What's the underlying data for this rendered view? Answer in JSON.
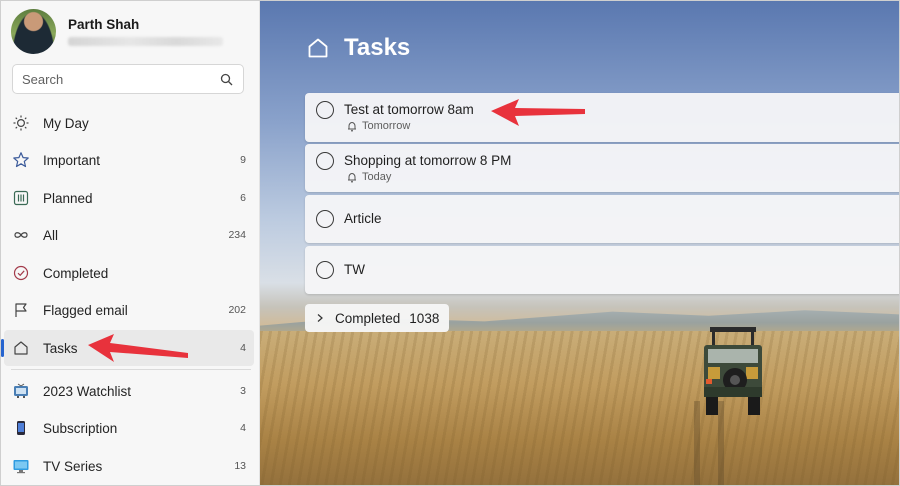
{
  "profile": {
    "name": "Parth Shah"
  },
  "search": {
    "placeholder": "Search"
  },
  "sidebar": {
    "items": [
      {
        "label": "My Day",
        "count": "",
        "icon": "sun-icon"
      },
      {
        "label": "Important",
        "count": "9",
        "icon": "star-icon"
      },
      {
        "label": "Planned",
        "count": "6",
        "icon": "calendar-icon"
      },
      {
        "label": "All",
        "count": "234",
        "icon": "infinity-icon"
      },
      {
        "label": "Completed",
        "count": "",
        "icon": "check-circle-icon"
      },
      {
        "label": "Flagged email",
        "count": "202",
        "icon": "flag-icon"
      },
      {
        "label": "Tasks",
        "count": "4",
        "icon": "home-icon"
      }
    ],
    "lists": [
      {
        "label": "2023 Watchlist",
        "count": "3",
        "icon": "tv-icon"
      },
      {
        "label": "Subscription",
        "count": "4",
        "icon": "phone-icon"
      },
      {
        "label": "TV Series",
        "count": "13",
        "icon": "monitor-icon"
      }
    ]
  },
  "main": {
    "title": "Tasks",
    "tasks": [
      {
        "title": "Test at tomorrow 8am",
        "reminder": "Tomorrow"
      },
      {
        "title": "Shopping at tomorrow 8 PM",
        "reminder": "Today"
      },
      {
        "title": "Article",
        "reminder": ""
      },
      {
        "title": "TW",
        "reminder": ""
      }
    ],
    "completed": {
      "label": "Completed",
      "count": "1038"
    }
  },
  "colors": {
    "accent": "#2564cf",
    "annotation_arrow": "#e8323c"
  }
}
